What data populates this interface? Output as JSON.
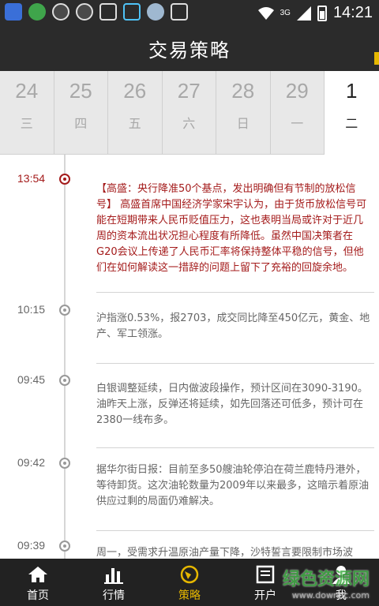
{
  "status_bar": {
    "network": "3G",
    "time": "14:21"
  },
  "header": {
    "title": "交易策略"
  },
  "dates": [
    {
      "num": "24",
      "weekday": "三",
      "active": false
    },
    {
      "num": "25",
      "weekday": "四",
      "active": false
    },
    {
      "num": "26",
      "weekday": "五",
      "active": false
    },
    {
      "num": "27",
      "weekday": "六",
      "active": false
    },
    {
      "num": "28",
      "weekday": "日",
      "active": false
    },
    {
      "num": "29",
      "weekday": "一",
      "active": false
    },
    {
      "num": "1",
      "weekday": "二",
      "active": true
    }
  ],
  "entries": [
    {
      "time": "13:54",
      "text": "【高盛：央行降准50个基点，发出明确但有节制的放松信号】 高盛首席中国经济学家宋宇认为，由于货币放松信号可能在短期带来人民币贬值压力，这也表明当局或许对于近几周的资本流出状况担心程度有所降低。虽然中国决策者在G20会议上传递了人民币汇率将保持整体平稳的信号，但他们在如何解读这一措辞的问题上留下了充裕的回旋余地。",
      "highlight": true
    },
    {
      "time": "10:15",
      "text": "沪指涨0.53%，报2703，成交同比降至450亿元，黄金、地产、军工领涨。",
      "highlight": false
    },
    {
      "time": "09:45",
      "text": "白银调整延续，日内做波段操作，预计区间在3090-3190。油昨天上涨，反弹还将延续，如先回落还可低多，预计可在2380一线布多。",
      "highlight": false
    },
    {
      "time": "09:42",
      "text": "据华尔街日报：目前至多50艘油轮停泊在荷兰鹿特丹港外，等待卸货。这次油轮数量为2009年以来最多，这暗示着原油供应过剩的局面仍难解决。",
      "highlight": false
    },
    {
      "time": "09:39",
      "text": "周一，受需求升温原油产量下降，沙特誓言要限制市场波",
      "highlight": false
    }
  ],
  "nav": [
    {
      "label": "首页",
      "icon": "home-icon",
      "active": false
    },
    {
      "label": "行情",
      "icon": "market-chart-icon",
      "active": false
    },
    {
      "label": "策略",
      "icon": "strategy-globe-icon",
      "active": true
    },
    {
      "label": "开户",
      "icon": "account-open-icon",
      "active": false
    },
    {
      "label": "我",
      "icon": "user-icon",
      "active": false
    }
  ],
  "watermark": {
    "main": "绿色资源网",
    "sub": "www.downcc.com"
  },
  "colors": {
    "header_bg": "#2b2b2b",
    "accent": "#e6b700",
    "highlight_red": "#a41b1b"
  }
}
